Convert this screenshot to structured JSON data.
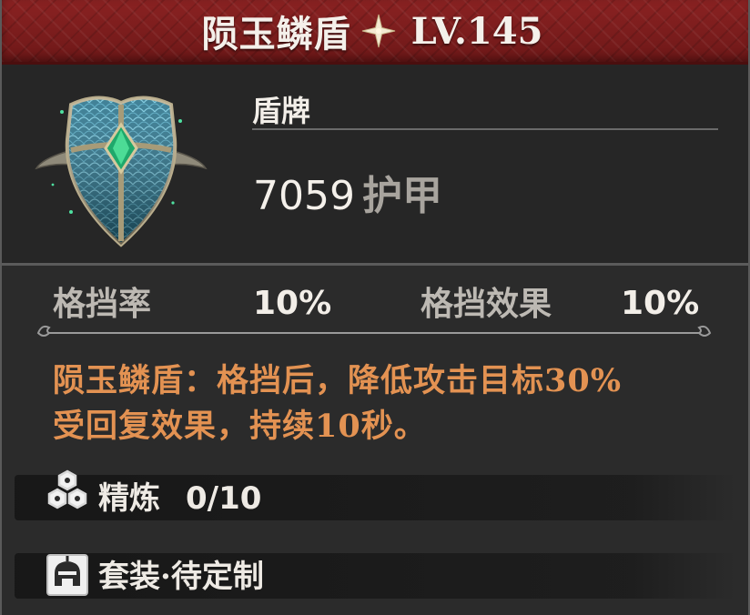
{
  "item": {
    "name": "陨玉鳞盾",
    "level": "LV.145",
    "type": "盾牌",
    "armor_value": "7059",
    "armor_unit": "护甲",
    "icon": "scaled-jade-shield-icon",
    "rarity_icon": "four-point-star-icon"
  },
  "stats": [
    {
      "label": "格挡率",
      "value": "10%"
    },
    {
      "label": "格挡效果",
      "value": "10%"
    }
  ],
  "description": {
    "line1": "陨玉鳞盾：格挡后，降低攻击目标30%",
    "line2": "受回复效果，持续10秒。"
  },
  "refine": {
    "label": "精炼",
    "value": "0/10",
    "icon": "refine-hexagons-icon"
  },
  "set": {
    "label": "套装·待定制",
    "icon": "set-helmet-icon"
  },
  "colors": {
    "header_red": "#7c1c1c",
    "description_orange": "#e39252",
    "panel_dark": "#2b2b2b"
  }
}
